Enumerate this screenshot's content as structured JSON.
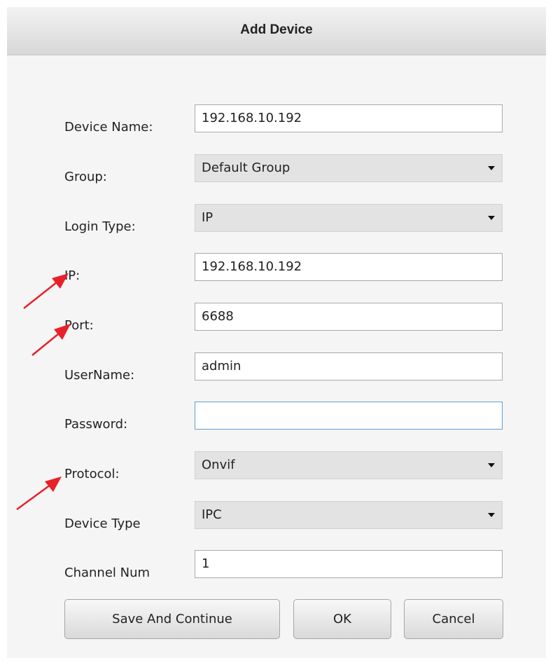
{
  "dialog": {
    "title": "Add Device"
  },
  "form": {
    "device_name": {
      "label": "Device Name:",
      "value": "192.168.10.192"
    },
    "group": {
      "label": "Group:",
      "value": "Default Group"
    },
    "login_type": {
      "label": "Login Type:",
      "value": "IP"
    },
    "ip": {
      "label": "IP:",
      "value": "192.168.10.192"
    },
    "port": {
      "label": "Port:",
      "value": "6688"
    },
    "username": {
      "label": "UserName:",
      "value": "admin"
    },
    "password": {
      "label": "Password:",
      "value": ""
    },
    "protocol": {
      "label": "Protocol:",
      "value": "Onvif"
    },
    "device_type": {
      "label": "Device Type",
      "value": "IPC"
    },
    "channel_num": {
      "label": "Channel Num",
      "value": "1"
    }
  },
  "buttons": {
    "save_continue": "Save And Continue",
    "ok": "OK",
    "cancel": "Cancel"
  },
  "colors": {
    "annotation_arrow": "#e8202a",
    "focus_border": "#5c9fd6"
  }
}
